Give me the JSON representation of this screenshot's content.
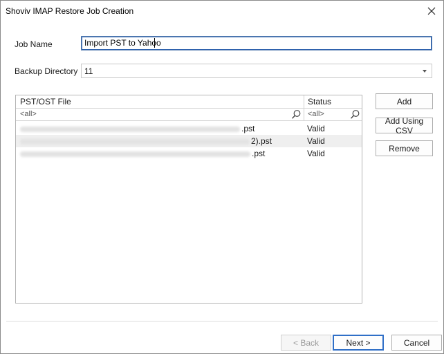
{
  "window": {
    "title": "Shoviv IMAP Restore Job Creation"
  },
  "form": {
    "job_name_label": "Job Name",
    "job_name_value": "Import PST to Yahoo",
    "backup_dir_label": "Backup Directory",
    "backup_dir_value": "11"
  },
  "grid": {
    "columns": [
      "PST/OST File",
      "Status"
    ],
    "filter_file": "<all>",
    "filter_status": "<all>",
    "rows": [
      {
        "file_suffix": ".pst",
        "status": "Valid"
      },
      {
        "file_suffix": "2).pst",
        "status": "Valid"
      },
      {
        "file_suffix": ".pst",
        "status": "Valid"
      }
    ]
  },
  "side_buttons": {
    "add": "Add",
    "add_csv": "Add Using CSV",
    "remove": "Remove"
  },
  "footer": {
    "back": "< Back",
    "next": "Next >",
    "cancel": "Cancel"
  },
  "colors": {
    "accent": "#2f6fc7",
    "row_alt": "#efefef",
    "disabled_text": "#9b9b9b"
  },
  "icons": {
    "close": "close-icon",
    "filter": "magnifier-icon",
    "combo": "chevron-down-icon"
  }
}
